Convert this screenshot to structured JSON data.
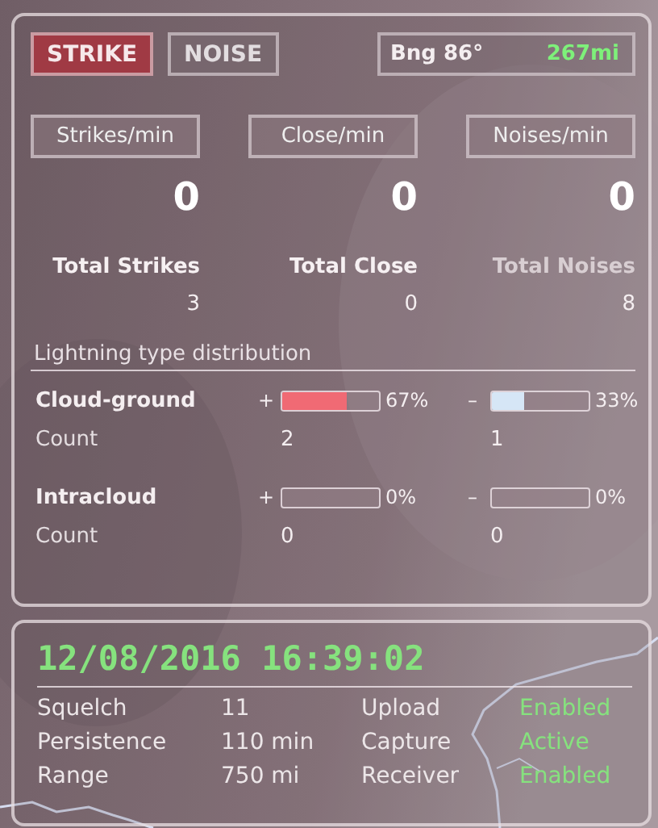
{
  "mode_buttons": [
    {
      "label": "STRIKE",
      "selected": true
    },
    {
      "label": "NOISE",
      "selected": false
    }
  ],
  "bearing": {
    "label": "Bng 86°",
    "distance": "267mi"
  },
  "rates": [
    {
      "label": "Strikes/min",
      "value": "0"
    },
    {
      "label": "Close/min",
      "value": "0"
    },
    {
      "label": "Noises/min",
      "value": "0"
    }
  ],
  "totals": [
    {
      "label": "Total Strikes",
      "value": "3"
    },
    {
      "label": "Total Close",
      "value": "0"
    },
    {
      "label": "Total Noises",
      "value": "8"
    }
  ],
  "distribution": {
    "title": "Lightning type distribution",
    "rows": [
      {
        "name": "Cloud-ground",
        "count_label": "Count",
        "polarities": [
          {
            "sign": "+",
            "level": 0.67,
            "reading": "67%",
            "count": "2",
            "color": "#f06a74"
          },
          {
            "sign": "–",
            "level": 0.33,
            "reading": "33%",
            "count": "1",
            "color": "#d6e6f6"
          }
        ]
      },
      {
        "name": "Intracloud",
        "count_label": "Count",
        "polarities": [
          {
            "sign": "+",
            "reading": "0%",
            "count": "0"
          },
          {
            "sign": "–",
            "reading": "0%",
            "count": "0"
          }
        ]
      }
    ]
  },
  "status": {
    "datetime": "12/08/2016 16:39:02",
    "rows": [
      {
        "label": "Squelch",
        "value": "11",
        "label2": "Upload",
        "value2": "Enabled"
      },
      {
        "label": "Persistence",
        "value": "110 min",
        "label2": "Capture",
        "value2": "Active"
      },
      {
        "label": "Range",
        "value": "750 mi",
        "label2": "Receiver",
        "value2": "Enabled"
      }
    ]
  }
}
